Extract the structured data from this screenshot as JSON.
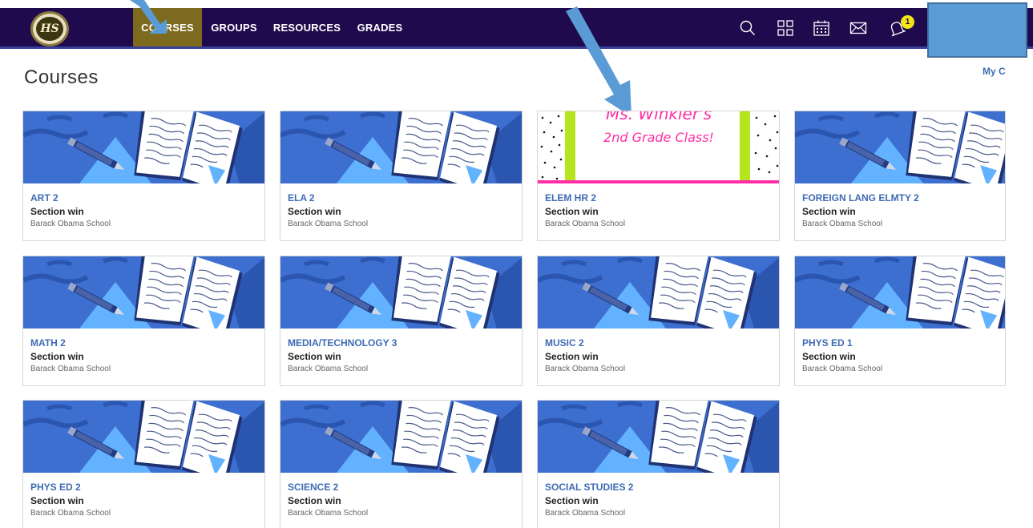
{
  "nav": {
    "logo_text": "HS",
    "items": [
      {
        "label": "COURSES",
        "active": true
      },
      {
        "label": "GROUPS",
        "active": false
      },
      {
        "label": "RESOURCES",
        "active": false
      },
      {
        "label": "GRADES",
        "active": false
      }
    ],
    "notification_count": "1",
    "icons": [
      "search-icon",
      "apps-grid-icon",
      "calendar-icon",
      "mail-icon",
      "bell-icon"
    ],
    "colors": {
      "bar": "#1f0a4d",
      "active": "#7d6a1f",
      "badge": "#f2e31b"
    }
  },
  "page": {
    "title": "Courses",
    "my_link": "My C"
  },
  "courses": [
    {
      "name": "ART 2",
      "section": "Section win",
      "school": "Barack Obama School"
    },
    {
      "name": "ELA 2",
      "section": "Section win",
      "school": "Barack Obama School"
    },
    {
      "name": "ELEM HR 2",
      "section": "Section win",
      "school": "Barack Obama School",
      "banner_line1": "Ms. Winkler's",
      "banner_line2": "2nd Grade Class!"
    },
    {
      "name": "FOREIGN LANG ELMTY 2",
      "section": "Section win",
      "school": "Barack Obama School"
    },
    {
      "name": "MATH 2",
      "section": "Section win",
      "school": "Barack Obama School"
    },
    {
      "name": "MEDIA/TECHNOLOGY 3",
      "section": "Section win",
      "school": "Barack Obama School"
    },
    {
      "name": "MUSIC 2",
      "section": "Section win",
      "school": "Barack Obama School"
    },
    {
      "name": "PHYS ED 1",
      "section": "Section win",
      "school": "Barack Obama School"
    },
    {
      "name": "PHYS ED 2",
      "section": "Section win",
      "school": "Barack Obama School"
    },
    {
      "name": "SCIENCE 2",
      "section": "Section win",
      "school": "Barack Obama School"
    },
    {
      "name": "SOCIAL STUDIES 2",
      "section": "Section win",
      "school": "Barack Obama School"
    }
  ],
  "annotation": {
    "arrow_color": "#5b9bd5",
    "box_color": "#5b9bd5"
  }
}
